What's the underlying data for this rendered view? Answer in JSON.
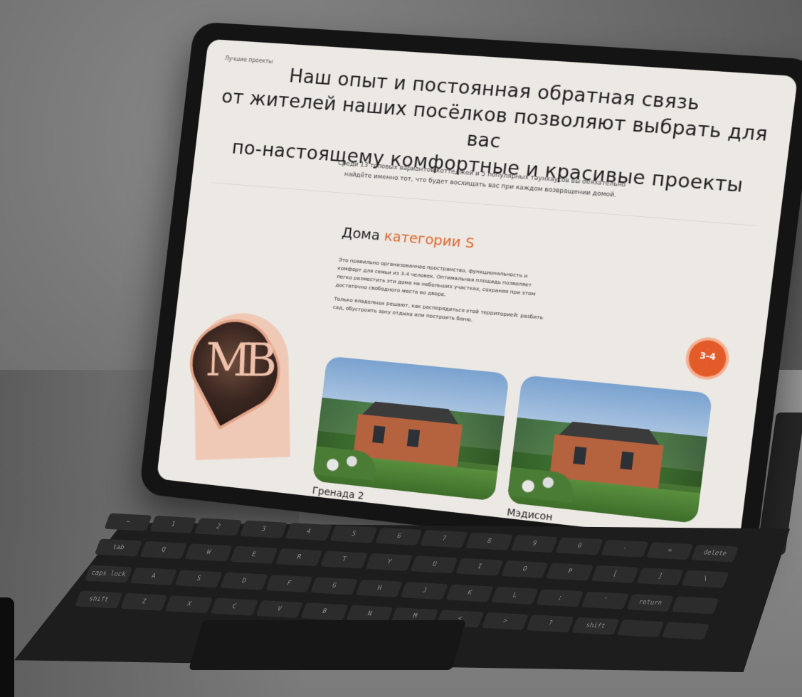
{
  "breadcrumb": "Лучшие проекты",
  "hero": {
    "title_line1": "Наш опыт и постоянная обратная связь",
    "title_line2": "от жителей наших посёлков позволяют выбрать для вас",
    "title_line3": "по-настоящему комфортные и красивые проекты",
    "subtitle_line1": "Среди 13 топовых вариантов коттеджей и 5 популярных таунхаусов вы обязательно",
    "subtitle_line2": "найдёте именно тот, что будет восхищать вас при каждом возвращении домой."
  },
  "section": {
    "title_prefix": "Дома",
    "title_accent": "категории S",
    "paragraph1": "Это правильно организованное пространство, функциональность и комфорт для семьи из 3-4 человек. Оптимальная площадь позволяет легко разместить эти дома на небольших участках, сохраняя при этом достаточно свободного места во дворе.",
    "paragraph2": "Только владельцы решают, как распорядиться этой территорией: разбить сад, обустроить зону отдыха или построить баню."
  },
  "badge": {
    "value": "3-4"
  },
  "logo": {
    "monogram": "МВ"
  },
  "cards": [
    {
      "name": "Гренада 2"
    },
    {
      "name": "Мэдисон"
    }
  ],
  "keyboard": {
    "keys": [
      "~",
      "1",
      "2",
      "3",
      "4",
      "5",
      "6",
      "7",
      "8",
      "9",
      "0",
      "-",
      "=",
      "delete",
      "tab",
      "Q",
      "W",
      "E",
      "R",
      "T",
      "Y",
      "U",
      "I",
      "O",
      "P",
      "[",
      "]",
      "\\",
      "caps lock",
      "A",
      "S",
      "D",
      "F",
      "G",
      "H",
      "J",
      "K",
      "L",
      ";",
      "'",
      "return",
      "",
      "shift",
      "Z",
      "X",
      "C",
      "V",
      "B",
      "N",
      "M",
      "<",
      ">",
      "?",
      "shift",
      "",
      ""
    ]
  },
  "colors": {
    "accent": "#e0662e",
    "screen_bg": "#ece8e4",
    "badge": "#e35b29",
    "logo_pink": "#f0c9b6"
  }
}
